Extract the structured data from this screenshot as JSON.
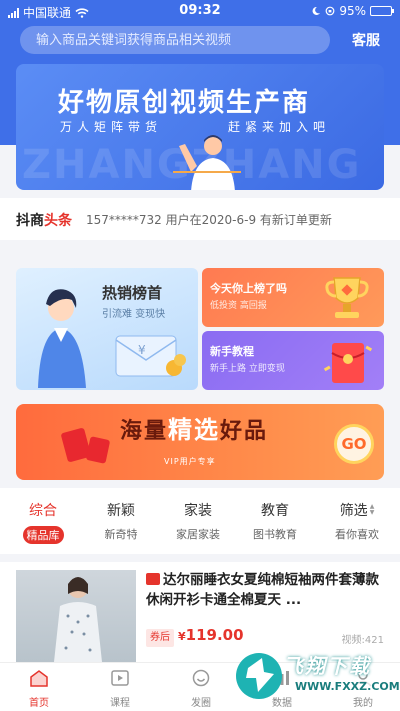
{
  "status_bar": {
    "carrier": "中国联通",
    "time": "09:32",
    "battery": "95%",
    "battery_level": 0.95
  },
  "search": {
    "placeholder": "输入商品关键词获得商品相关视频",
    "service_label": "客服"
  },
  "banner": {
    "title": "好物原创视频生产商",
    "sub_left": "万人矩阵带货",
    "sub_right": "赶紧来加入吧",
    "watermark": "ZHANGZHANG"
  },
  "ticker": {
    "brand_a": "抖商",
    "brand_b": "头条",
    "message": "157*****732 用户在2020-6-9 有新订单更新"
  },
  "cards": {
    "hot": {
      "title": "热销榜首",
      "subtitle": "引流难  变现快"
    },
    "listed": {
      "title": "今天你上榜了吗",
      "subtitle": "低投资  高回报"
    },
    "tutorial": {
      "title": "新手教程",
      "subtitle": "新手上路  立即变现"
    }
  },
  "promo": {
    "title_a": "海量",
    "title_hl": "精选",
    "title_b": "好品",
    "subtitle": "VIP用户专享",
    "go": "GO"
  },
  "tabs": [
    {
      "label": "综合",
      "sub": "精品库"
    },
    {
      "label": "新颖",
      "sub": "新奇特"
    },
    {
      "label": "家装",
      "sub": "家居家装"
    },
    {
      "label": "教育",
      "sub": "图书教育"
    },
    {
      "label": "筛选",
      "sub": "看你喜欢"
    }
  ],
  "product": {
    "title": "达尔丽睡衣女夏纯棉短袖两件套薄款休闲开衫卡通全棉夏天 ...",
    "coupon": "券后",
    "currency": "¥",
    "price": "119.00",
    "video": "视频:421"
  },
  "nav": [
    {
      "label": "首页"
    },
    {
      "label": "课程"
    },
    {
      "label": "发圈"
    },
    {
      "label": "数据"
    },
    {
      "label": "我的"
    }
  ],
  "brand_watermark": {
    "text": "飞翔下载",
    "url": "WWW.FXXZ.COM"
  },
  "colors": {
    "primary_blue": "#3f6fe8",
    "accent_red": "#e5342c",
    "promo_orange": "#ff6b3d"
  }
}
